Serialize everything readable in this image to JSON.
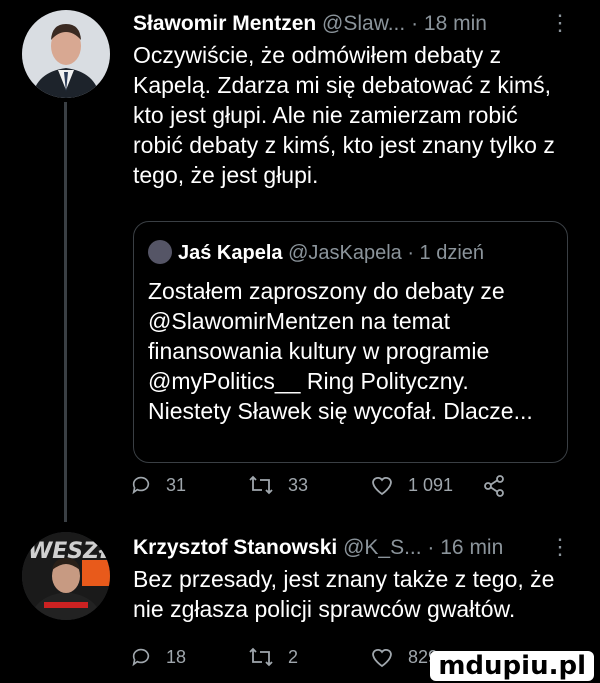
{
  "tweet1": {
    "name": "Sławomir Mentzen",
    "handle": "@Slaw...",
    "time": "· 18 min",
    "more": "⋮",
    "text": "Oczywiście, że odmówiłem debaty z Kapelą. Zdarza mi się debatować z kimś, kto jest głupi. Ale nie zamierzam robić robić debaty z kimś, kto jest znany tylko z tego, że jest głupi.",
    "quote": {
      "name": "Jaś Kapela",
      "handle": "@JasKapela · 1 dzień",
      "text": "Zostałem zaproszony do debaty ze @SlawomirMentzen na temat finansowania kultury w programie @myPolitics__ Ring Polityczny. Niestety Sławek się wycofał. Dlacze..."
    },
    "actions": {
      "replies": "31",
      "retweets": "33",
      "likes": "1 091"
    }
  },
  "tweet2": {
    "name": "Krzysztof Stanowski",
    "handle": "@K_S...",
    "time": "· 16 min",
    "more": "⋮",
    "text": "Bez przesady, jest znany także z tego, że nie zgłasza policji sprawców gwałtów.",
    "actions": {
      "replies": "18",
      "retweets": "2",
      "likes": "829"
    }
  },
  "watermark": "mdupiu.pl",
  "colors": {
    "background": "#000000",
    "muted": "#8b949b",
    "divider": "#3a3f44"
  },
  "icons": [
    "reply-icon",
    "retweet-icon",
    "like-icon",
    "share-icon",
    "more-icon"
  ]
}
